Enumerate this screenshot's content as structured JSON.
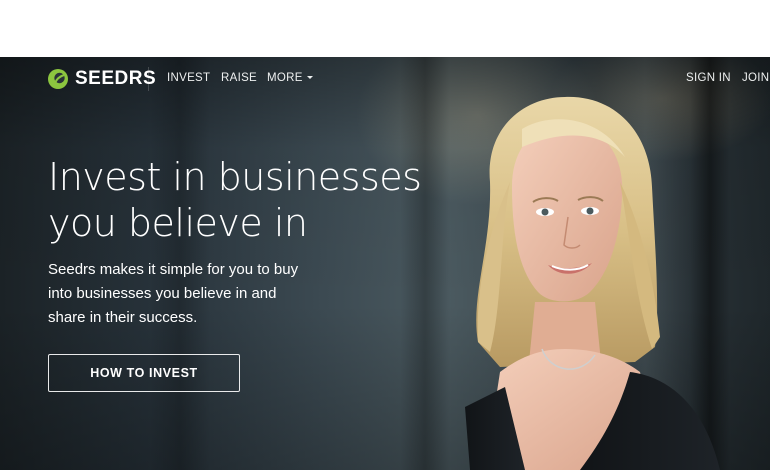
{
  "brand": {
    "name": "SEEDRS",
    "logo_icon": "seedrs-leaf-icon",
    "accent_color": "#8cc63f"
  },
  "nav": {
    "items": [
      {
        "label": "INVEST"
      },
      {
        "label": "RAISE"
      },
      {
        "label": "MORE",
        "icon": "caret-down-icon"
      }
    ],
    "right": {
      "signin": "SIGN IN",
      "join": "JOIN"
    }
  },
  "hero": {
    "headline_line1": "Invest in businesses",
    "headline_line2": "you believe in",
    "subcopy_line1": "Seedrs makes it simple for you to buy",
    "subcopy_line2": "into businesses you believe in and",
    "subcopy_line3": "share in their success.",
    "cta_label": "HOW TO INVEST",
    "image": "portrait-photo"
  }
}
